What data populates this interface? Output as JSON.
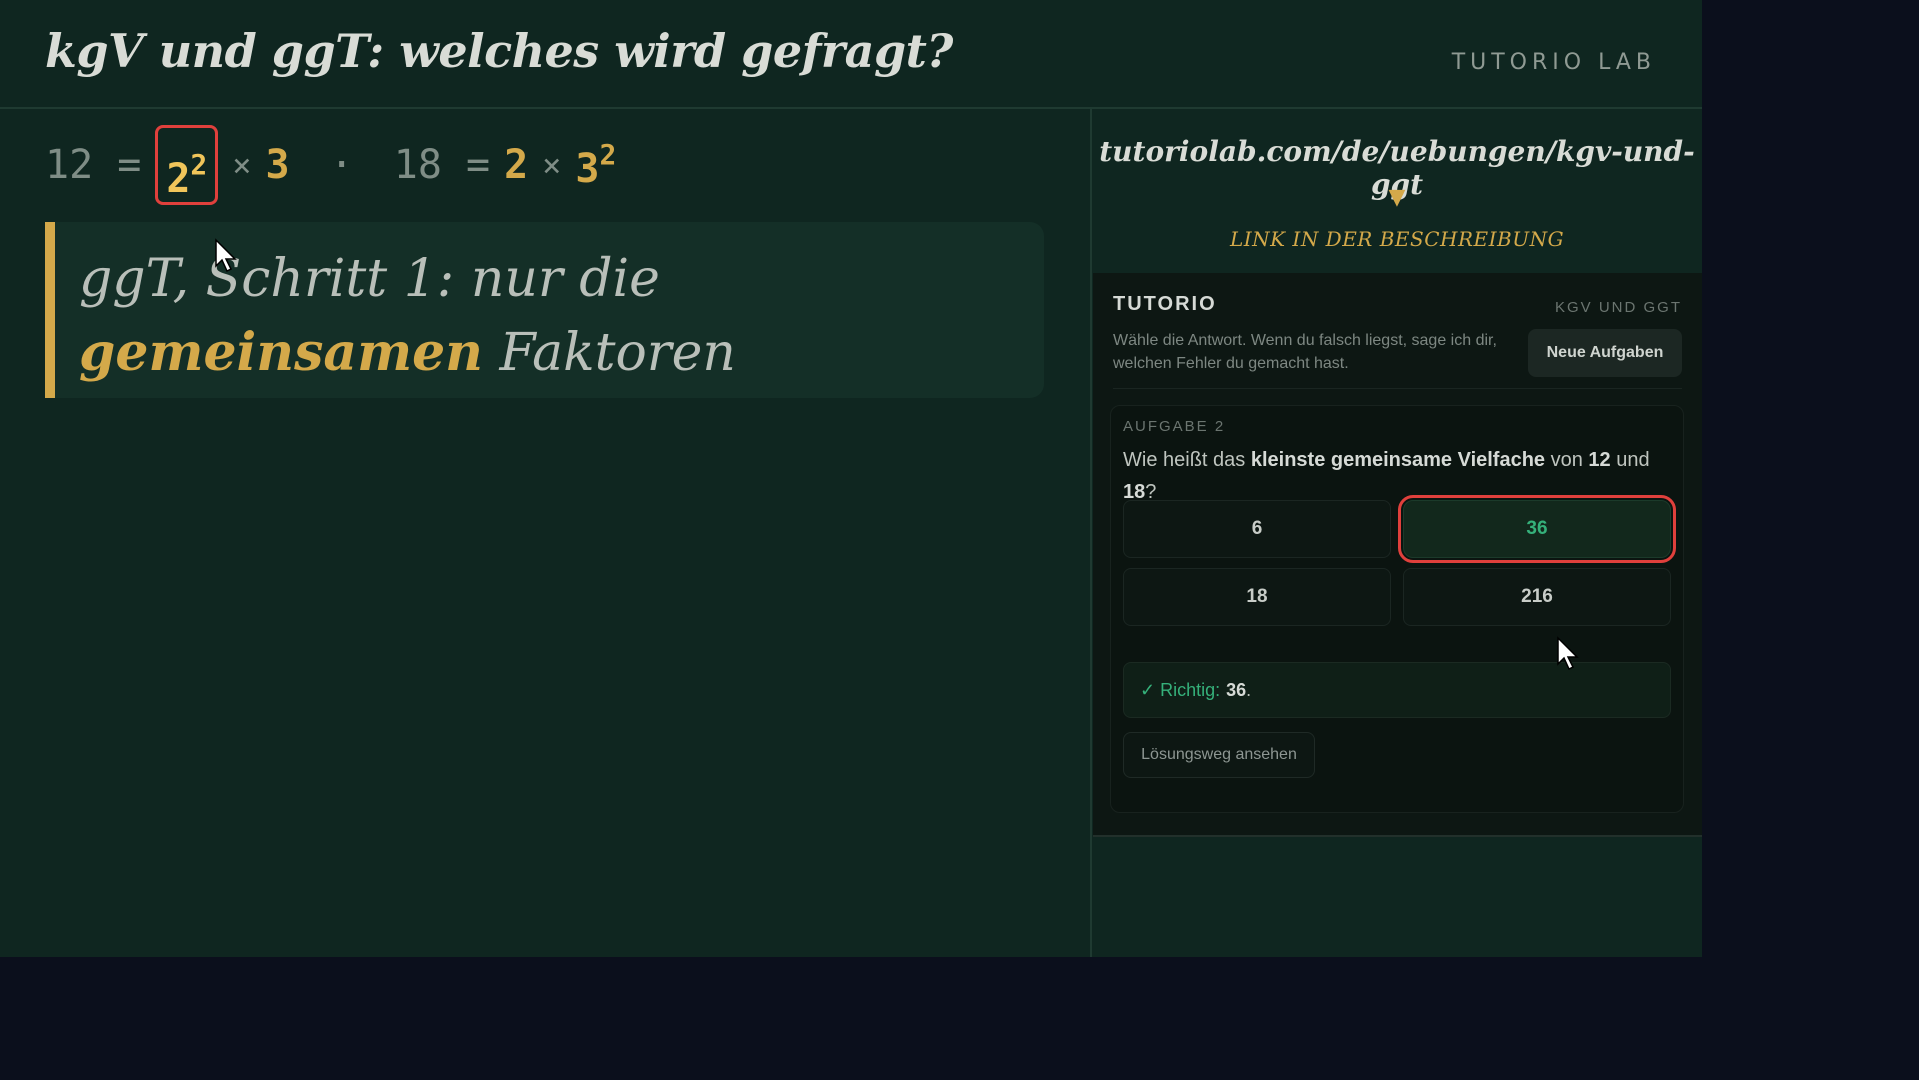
{
  "header": {
    "title": "kgV und ggT: welches wird gefragt?",
    "brand": "TUTORIO LAB"
  },
  "equation": {
    "left_base": "12 =",
    "boxed_base": "2",
    "boxed_exp": "2",
    "times1": "×",
    "factor3": "3",
    "sep": "·",
    "right_base": "18 =",
    "factor2": "2",
    "times2": "×",
    "right_3": "3",
    "right_exp": "2"
  },
  "callout": {
    "line1": "ggT, Schritt 1: nur die",
    "highlight": "gemeinsamen",
    "line2_rest": " Faktoren"
  },
  "sidebar": {
    "url": "tutoriolab.com/de/uebungen/kgv-und-ggt",
    "arrow": "▼",
    "link_hint": "LINK IN DER BESCHREIBUNG"
  },
  "widget": {
    "title": "TUTORIO",
    "topic": "KGV UND GGT",
    "description": "Wähle die Antwort. Wenn du falsch liegst, sage ich dir, welchen Fehler du gemacht hast.",
    "new_button": "Neue Aufgaben",
    "task": {
      "label": "AUFGABE 2",
      "q_part1": "Wie heißt das ",
      "q_bold1": "kleinste gemeinsame Vielfache",
      "q_part2": " von ",
      "q_bold2": "12",
      "q_part3": " und ",
      "q_bold3": "18",
      "q_part4": "?",
      "options": [
        "6",
        "36",
        "18",
        "216"
      ],
      "selected": "36",
      "result_prefix": "✓ Richtig:",
      "result_value": "36",
      "result_suffix": ".",
      "solution_button": "Lösungsweg ansehen"
    }
  },
  "colors": {
    "accent": "#d4a94a",
    "correct": "#35b07a",
    "highlight_box": "#e0403c",
    "board": "#0f2620"
  }
}
